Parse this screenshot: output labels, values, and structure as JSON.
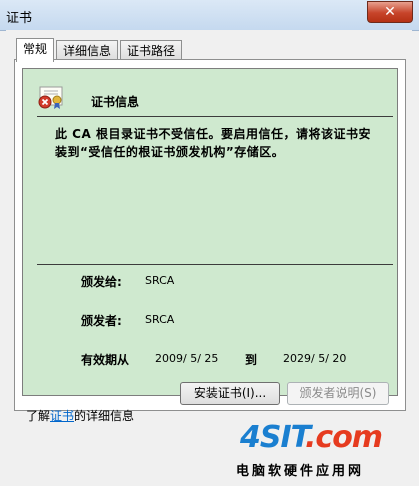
{
  "window": {
    "title": "证书",
    "close_label": "✕"
  },
  "tabs": [
    {
      "label": "常规",
      "active": true
    },
    {
      "label": "详细信息",
      "active": false
    },
    {
      "label": "证书路径",
      "active": false
    }
  ],
  "certificate": {
    "section_title": "证书信息",
    "message": "此 CA 根目录证书不受信任。要启用信任，请将该证书安装到“受信任的根证书颁发机构”存储区。",
    "issued_to_label": "颁发给:",
    "issued_to_value": "SRCA",
    "issued_by_label": "颁发者:",
    "issued_by_value": "SRCA",
    "validity_label": "有效期从",
    "valid_from": "2009/ 5/ 25",
    "to_label": "到",
    "valid_to": "2029/ 5/ 20"
  },
  "buttons": {
    "install_label": "安装证书(I)...",
    "issuer_statement_label": "颁发者说明(S)"
  },
  "learn_more": {
    "prefix": "了解",
    "link": "证书",
    "suffix": "的详细信息"
  },
  "watermark": {
    "logo_main": "4SIT",
    "logo_dot": ".com",
    "subtitle": "电脑软硬件应用网"
  },
  "colors": {
    "panel_green": "#cfe9cf",
    "link_blue": "#0066cc",
    "close_red": "#c7442a"
  }
}
